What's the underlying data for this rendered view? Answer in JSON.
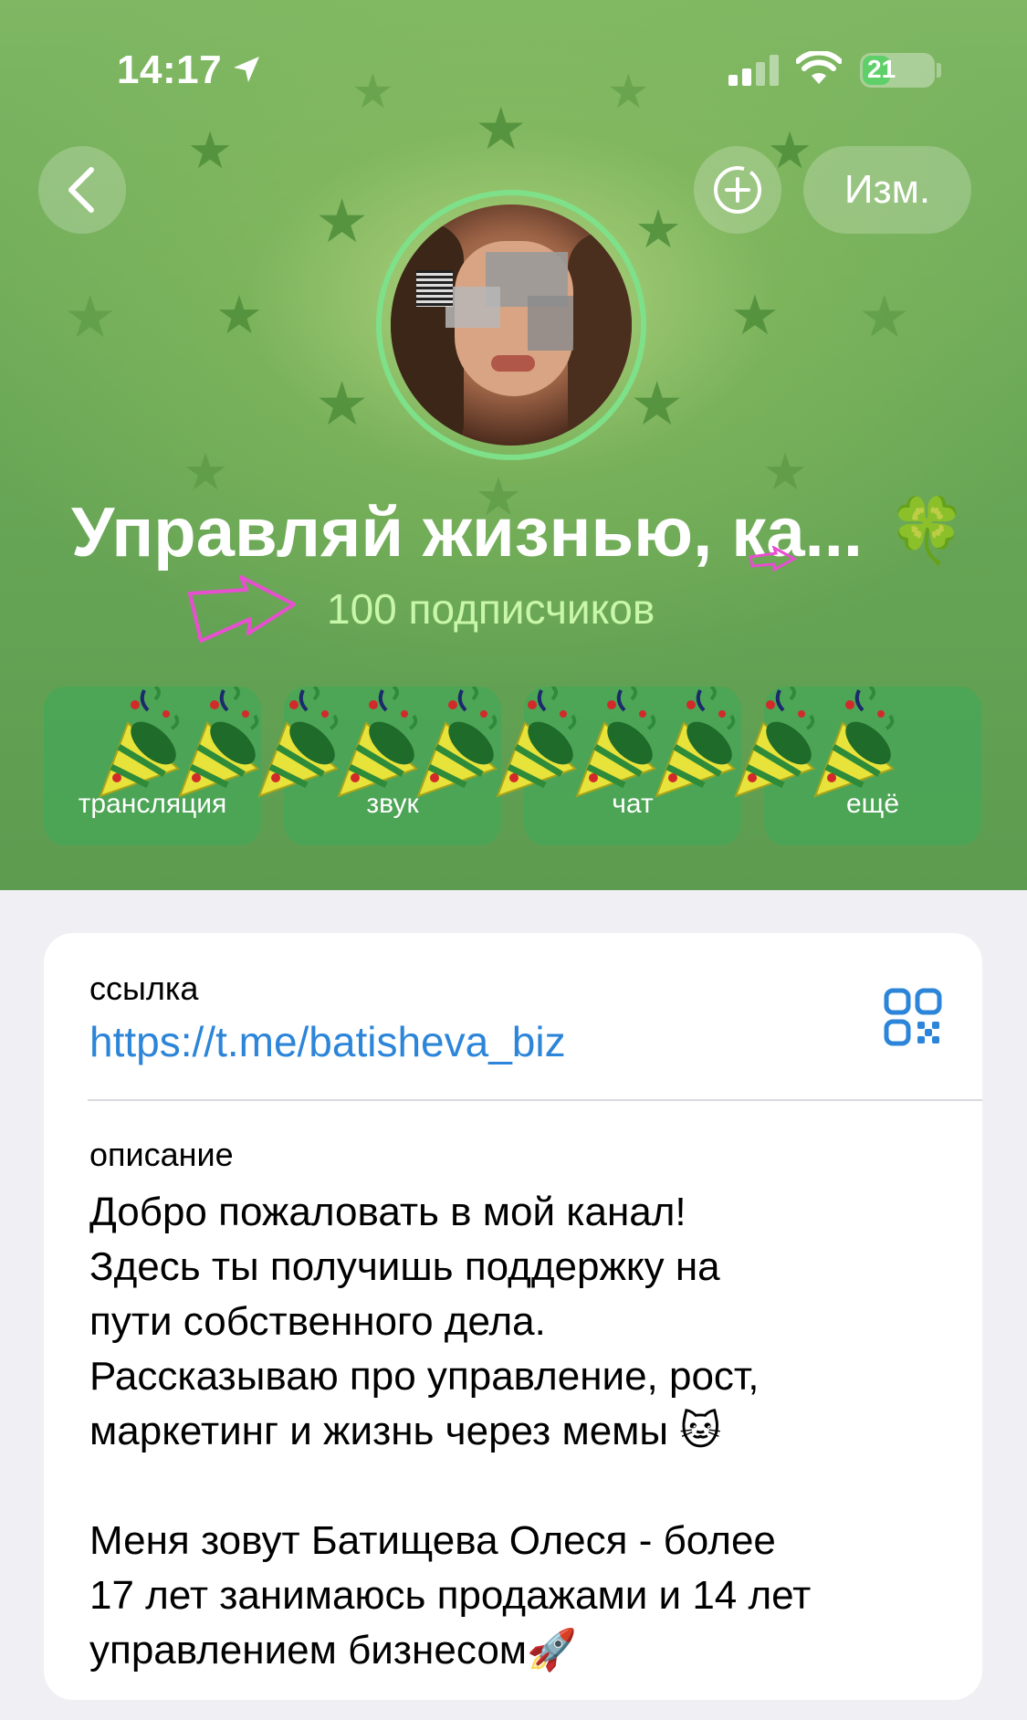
{
  "status_bar": {
    "time": "14:17",
    "battery": "21"
  },
  "nav": {
    "back_icon": "chevron-left-icon",
    "add_icon": "add-circle-icon",
    "edit_label": "Изм."
  },
  "channel": {
    "title": "Управляй жизнью, ка...",
    "title_emoji": "🍀",
    "subscribers": "100 подписчиков"
  },
  "actions": [
    {
      "label": "трансляция",
      "icon": "broadcast-icon"
    },
    {
      "label": "звук",
      "icon": "sound-icon"
    },
    {
      "label": "чат",
      "icon": "chat-icon"
    },
    {
      "label": "ещё",
      "icon": "more-icon"
    }
  ],
  "info": {
    "link_label": "ссылка",
    "link_value": "https://t.me/batisheva_biz",
    "qr_icon": "qr-code-icon",
    "description_label": "описание",
    "description_lines": [
      "Добро пожаловать в мой канал!",
      "Здесь ты получишь поддержку на",
      "пути собственного дела.",
      "Рассказываю про управление, рост,",
      "маркетинг и жизнь через мемы 🐱",
      "",
      "Меня зовут Батищева Олеся - более",
      "17 лет занимаюсь продажами и 14 лет",
      "управлением бизнесом🚀"
    ]
  },
  "colors": {
    "header_green": "#6aa857",
    "link_blue": "#2c85d8",
    "subscriber_green": "#c9f7a9",
    "avatar_ring": "#7ee089"
  }
}
